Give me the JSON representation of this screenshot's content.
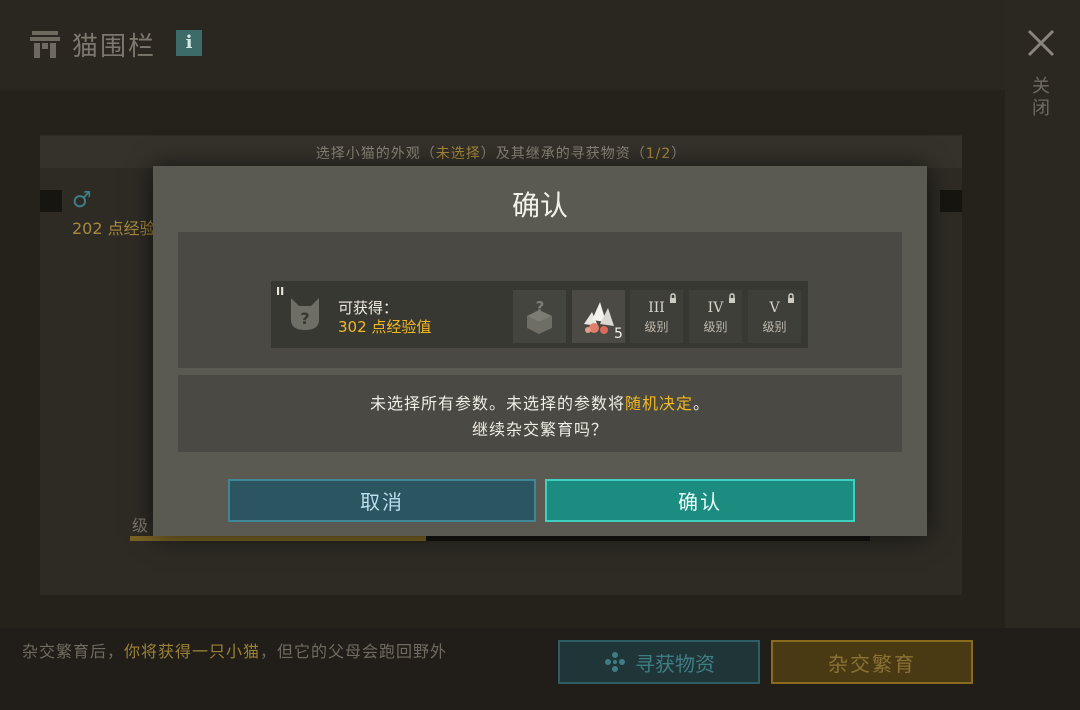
{
  "header": {
    "title": "猫围栏",
    "info_label": "i",
    "close_label": "关闭"
  },
  "background": {
    "hint_prefix": "选择小猫的外观（",
    "hint_highlight1": "未选择",
    "hint_middle": "）及其继承的寻获物资（",
    "hint_highlight2": "1/2",
    "hint_suffix": "）",
    "xp_text": "202 点经验",
    "level_text": "级",
    "level_progress": 0.4
  },
  "footer": {
    "text_prefix": "杂交繁育后，",
    "text_highlight": "你将获得一只小猫",
    "text_suffix": "，但它的父母会跑回野外",
    "forage_button": "寻获物资",
    "breed_button": "杂交繁育"
  },
  "dialog": {
    "title": "确认",
    "tier": "II",
    "gain_label": "可获得：",
    "gain_xp": "302 点经验值",
    "item_count": "5",
    "levels": [
      {
        "num": "III",
        "label": "级别"
      },
      {
        "num": "IV",
        "label": "级别"
      },
      {
        "num": "V",
        "label": "级别"
      }
    ],
    "message_prefix": "未选择所有参数。未选择的参数将",
    "message_highlight": "随机决定",
    "message_suffix": "。",
    "message_line2": "继续杂交繁育吗？",
    "cancel_label": "取消",
    "confirm_label": "确认"
  },
  "colors": {
    "accent_yellow": "#f2b820",
    "confirm_teal": "#1d8c80",
    "cancel_blue": "#2b5561"
  }
}
